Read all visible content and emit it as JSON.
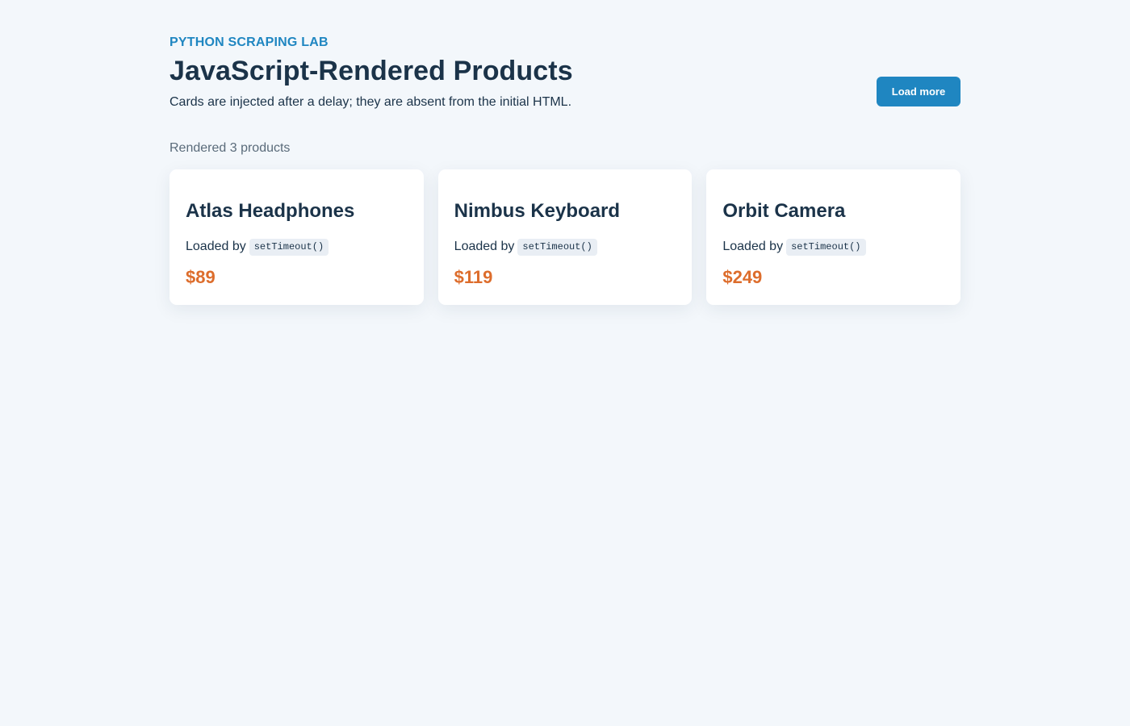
{
  "header": {
    "eyebrow": "PYTHON SCRAPING LAB",
    "title": "JavaScript-Rendered Products",
    "subtitle": "Cards are injected after a delay; they are absent from the initial HTML.",
    "load_more_label": "Load more"
  },
  "status": "Rendered 3 products",
  "products": [
    {
      "name": "Atlas Headphones",
      "loaded_by_label": "Loaded by",
      "loader": "setTimeout()",
      "price": "$89"
    },
    {
      "name": "Nimbus Keyboard",
      "loaded_by_label": "Loaded by",
      "loader": "setTimeout()",
      "price": "$119"
    },
    {
      "name": "Orbit Camera",
      "loaded_by_label": "Loaded by",
      "loader": "setTimeout()",
      "price": "$249"
    }
  ],
  "colors": {
    "accent": "#1f86c1",
    "price": "#dd6d2c",
    "text": "#1b3349",
    "background": "#f3f7fb"
  }
}
